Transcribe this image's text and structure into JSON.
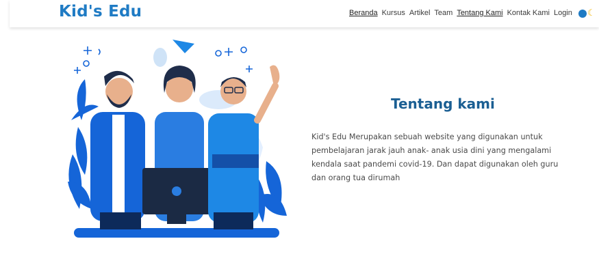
{
  "brand": {
    "name": "Kid's Edu",
    "color": "#1f7bc4"
  },
  "nav": {
    "links": [
      {
        "label": "Beranda",
        "underlined": true
      },
      {
        "label": "Kursus",
        "underlined": false
      },
      {
        "label": "Artikel",
        "underlined": false
      },
      {
        "label": "Team",
        "underlined": false
      },
      {
        "label": "Tentang Kami",
        "underlined": true
      },
      {
        "label": "Kontak Kami",
        "underlined": false
      },
      {
        "label": "Login",
        "underlined": false
      }
    ],
    "theme_toggle": {
      "icons": [
        "circle-dot-icon",
        "moon-icon"
      ],
      "colors": [
        "#1f7bc4",
        "#f2b400"
      ]
    }
  },
  "about": {
    "title": "Tentang kami",
    "description": "Kid's Edu Merupakan sebuah website yang digunakan untuk pembelajaran jarak jauh anak- anak usia dini yang mengalami kendala saat pandemi covid-19. Dan dapat digunakan oleh guru dan orang tua dirumah"
  },
  "illustration": {
    "name": "team-of-three-people-illustration",
    "accent": "#1565d8"
  }
}
